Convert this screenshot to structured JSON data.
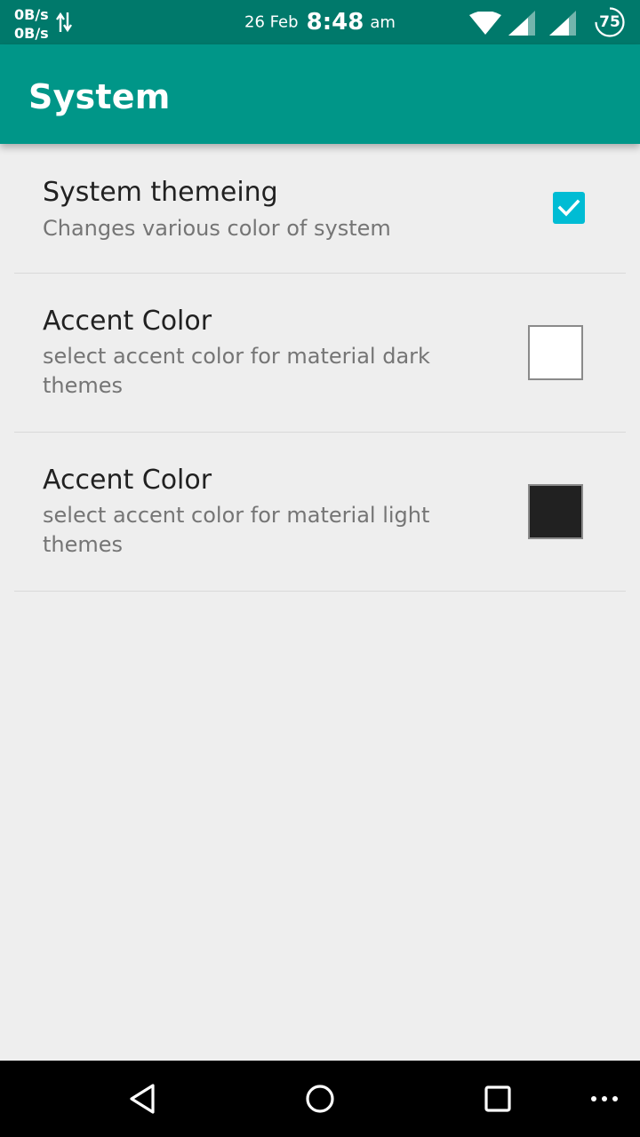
{
  "status_bar": {
    "net_up": "0B/s",
    "net_down": "0B/s",
    "date": "26 Feb",
    "time": "8:48",
    "ampm": "am",
    "battery_level": "75",
    "icons": [
      "data-transfer-arrows-icon",
      "wifi-icon",
      "cell-signal-icon",
      "cell-signal-icon",
      "battery-icon"
    ]
  },
  "app_bar": {
    "title": "System",
    "color": "#009688"
  },
  "preferences": [
    {
      "title": "System themeing",
      "summary": "Changes various color of system",
      "widget": "checkbox",
      "checked": true,
      "widget_color": "#00bcd4"
    },
    {
      "title": "Accent Color",
      "summary": "select accent color for material dark themes",
      "widget": "color-swatch",
      "swatch_color": "#ffffff"
    },
    {
      "title": "Accent Color",
      "summary": "select accent color for material light themes",
      "widget": "color-swatch",
      "swatch_color": "#212121"
    }
  ],
  "nav_bar": {
    "icons": [
      "back-icon",
      "home-icon",
      "recents-icon",
      "more-icon"
    ]
  },
  "colors": {
    "status_bar": "#00796b",
    "background": "#eeeeee",
    "title_text": "#212121",
    "summary_text": "#757575"
  }
}
